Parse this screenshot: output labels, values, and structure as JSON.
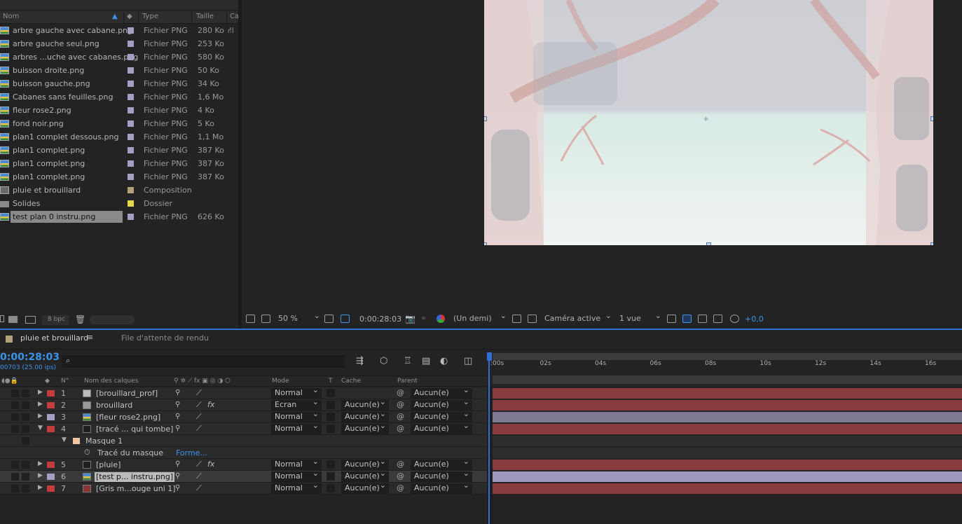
{
  "project": {
    "columns": {
      "name": "Nom",
      "type": "Type",
      "size": "Taille",
      "cache": "Ca"
    },
    "items": [
      {
        "name": "arbre gauche avec cabane.png",
        "type": "Fichier PNG",
        "size": "280 Ko",
        "icon": "png-file-icon",
        "label_color": "#a4a0c4"
      },
      {
        "name": "arbre gauche seul.png",
        "type": "Fichier PNG",
        "size": "253 Ko",
        "icon": "png-file-icon",
        "label_color": "#a4a0c4"
      },
      {
        "name": "arbres ...uche avec cabanes.png",
        "type": "Fichier PNG",
        "size": "580 Ko",
        "icon": "png-file-icon",
        "label_color": "#a4a0c4"
      },
      {
        "name": "buisson droite.png",
        "type": "Fichier PNG",
        "size": "50 Ko",
        "icon": "png-file-icon",
        "label_color": "#a4a0c4"
      },
      {
        "name": "buisson gauche.png",
        "type": "Fichier PNG",
        "size": "34 Ko",
        "icon": "png-file-icon",
        "label_color": "#a4a0c4"
      },
      {
        "name": "Cabanes sans feuilles.png",
        "type": "Fichier PNG",
        "size": "1,6 Mo",
        "icon": "png-file-icon",
        "label_color": "#a4a0c4"
      },
      {
        "name": "fleur rose2.png",
        "type": "Fichier PNG",
        "size": "4 Ko",
        "icon": "png-file-icon",
        "label_color": "#a4a0c4"
      },
      {
        "name": "fond noir.png",
        "type": "Fichier PNG",
        "size": "5 Ko",
        "icon": "png-file-icon",
        "label_color": "#a4a0c4"
      },
      {
        "name": "plan1 complet dessous.png",
        "type": "Fichier PNG",
        "size": "1,1 Mo",
        "icon": "png-file-icon",
        "label_color": "#a4a0c4"
      },
      {
        "name": "plan1 complet.png",
        "type": "Fichier PNG",
        "size": "387 Ko",
        "icon": "png-file-icon",
        "label_color": "#a4a0c4"
      },
      {
        "name": "plan1 complet.png",
        "type": "Fichier PNG",
        "size": "387 Ko",
        "icon": "png-file-icon",
        "label_color": "#a4a0c4"
      },
      {
        "name": "plan1 complet.png",
        "type": "Fichier PNG",
        "size": "387 Ko",
        "icon": "png-file-icon",
        "label_color": "#a4a0c4"
      },
      {
        "name": "pluie et brouillard",
        "type": "Composition",
        "size": "",
        "icon": "composition-icon",
        "label_color": "#b3a17c"
      },
      {
        "name": "Solides",
        "type": "Dossier",
        "size": "",
        "icon": "folder-icon",
        "label_color": "#e3d84a"
      },
      {
        "name": "test plan 0 instru.png",
        "type": "Fichier PNG",
        "size": "626 Ko",
        "icon": "png-file-icon",
        "label_color": "#a4a0c4",
        "selected": true
      }
    ],
    "footer": {
      "bpc": "8 bpc"
    }
  },
  "viewer": {
    "zoom": "50 %",
    "timecode": "0:00:28:03",
    "resolution": "(Un demi)",
    "camera": "Caméra active",
    "views": "1 vue",
    "exposure": "+0,0"
  },
  "timeline": {
    "tabs": [
      {
        "label": "pluie et brouillard",
        "active": true,
        "color": "#b3a17c"
      },
      {
        "label": "File d'attente de rendu",
        "active": false
      }
    ],
    "current_time": "0:00:28:03",
    "fps_label": "00703 (25.00 ips)",
    "columns": {
      "num": "N°",
      "name": "Nom des calques",
      "mode": "Mode",
      "t": "T",
      "cache": "Cache",
      "parent": "Parent"
    },
    "ruler_labels": [
      ":00s",
      "02s",
      "04s",
      "06s",
      "08s",
      "10s",
      "12s",
      "14s",
      "16s"
    ],
    "layers": [
      {
        "num": "1",
        "name": "[brouillard_prof]",
        "mode": "Normal",
        "cache": "",
        "parent": "Aucun(e)",
        "label_color": "#c53c3c",
        "swatch": "#bcbcbc",
        "fx": false,
        "bar_color": "#8a3b3e"
      },
      {
        "num": "2",
        "name": "brouillard",
        "mode": "Ecran",
        "cache": "Aucun(e)",
        "parent": "Aucun(e)",
        "label_color": "#c53c3c",
        "swatch": "#9a9a9a",
        "fx": true,
        "bar_color": "#8a3b3e"
      },
      {
        "num": "3",
        "name": "[fleur rose2.png]",
        "mode": "Normal",
        "cache": "Aucun(e)",
        "parent": "Aucun(e)",
        "label_color": "#a4a0c4",
        "swatch": "png",
        "fx": false,
        "bar_color": "#7b7a91"
      },
      {
        "num": "4",
        "name": "[tracé ... qui tombe]",
        "mode": "Normal",
        "cache": "Aucun(e)",
        "parent": "Aucun(e)",
        "label_color": "#c53c3c",
        "swatch": "#1e1e1e",
        "fx": false,
        "bar_color": "#8a3b3e",
        "expanded": true
      },
      {
        "num": "5",
        "name": "[pluie]",
        "mode": "Normal",
        "cache": "Aucun(e)",
        "parent": "Aucun(e)",
        "label_color": "#c53c3c",
        "swatch": "#1e1e1e",
        "fx": true,
        "bar_color": "#8a3b3e"
      },
      {
        "num": "6",
        "name": "[test p... instru.png]",
        "mode": "Normal",
        "cache": "Aucun(e)",
        "parent": "Aucun(e)",
        "label_color": "#a4a0c4",
        "swatch": "png",
        "fx": false,
        "bar_color": "#9c98c0",
        "selected": true
      },
      {
        "num": "7",
        "name": "[Gris m...ouge uni 1]",
        "mode": "Normal",
        "cache": "Aucun(e)",
        "parent": "Aucun(e)",
        "label_color": "#c53c3c",
        "swatch": "#8a3434",
        "fx": false,
        "bar_color": "#8a3b3e"
      }
    ],
    "mask": {
      "name": "Masque 1",
      "property": "Tracé du masque",
      "value": "Forme..."
    }
  }
}
